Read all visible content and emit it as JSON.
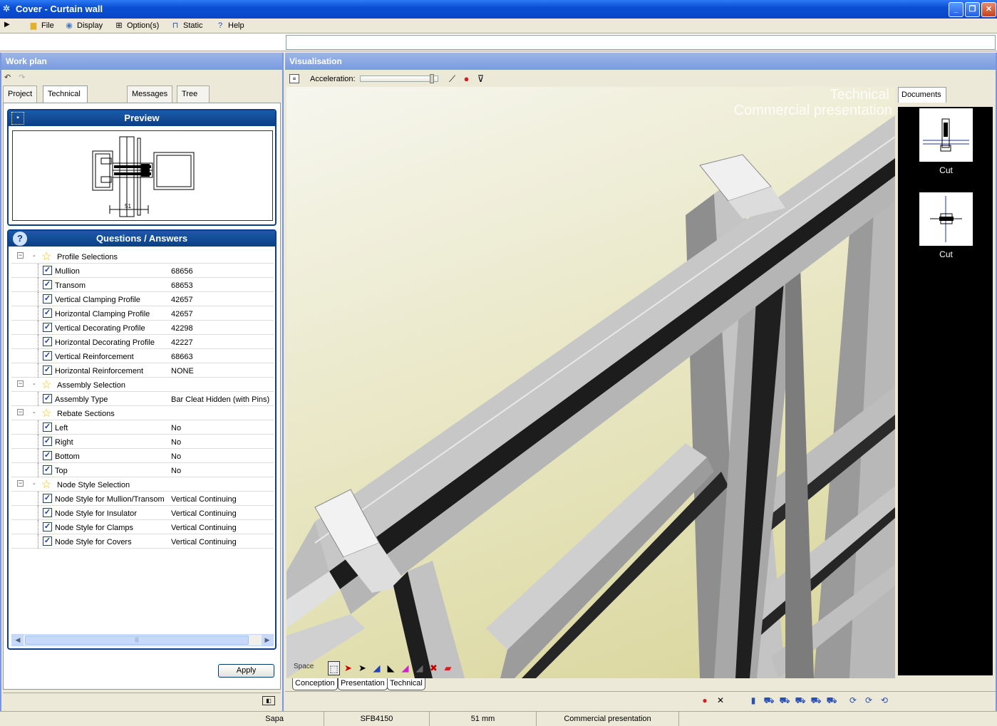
{
  "window": {
    "title": "Cover - Curtain wall",
    "minimize_glyph": "_",
    "maximize_glyph": "❐",
    "close_glyph": "✕"
  },
  "menu": {
    "items": [
      {
        "label": "File",
        "icon": "folder-icon"
      },
      {
        "label": "Display",
        "icon": "display-icon"
      },
      {
        "label": "Option(s)",
        "icon": "options-icon"
      },
      {
        "label": "Static",
        "icon": "static-icon"
      },
      {
        "label": "Help",
        "icon": "help-icon"
      }
    ]
  },
  "left_panel": {
    "header": "Work plan",
    "tabs": [
      {
        "label": "Project"
      },
      {
        "label": "Technical properties",
        "active": true
      },
      {
        "label": "Messages"
      },
      {
        "label": "Tree view cutting list"
      }
    ],
    "preview": {
      "title": "Preview",
      "dimension_label": "51"
    },
    "qa": {
      "title": "Questions / Answers",
      "groups": [
        {
          "label": "Profile Selections",
          "items": [
            {
              "q": "Mullion",
              "a": "68656"
            },
            {
              "q": "Transom",
              "a": "68653"
            },
            {
              "q": "Vertical Clamping Profile",
              "a": "42657"
            },
            {
              "q": "Horizontal Clamping Profile",
              "a": "42657"
            },
            {
              "q": "Vertical Decorating Profile",
              "a": "42298"
            },
            {
              "q": "Horizontal Decorating Profile",
              "a": "42227"
            },
            {
              "q": "Vertical Reinforcement",
              "a": "68663"
            },
            {
              "q": "Horizontal Reinforcement",
              "a": "NONE"
            }
          ]
        },
        {
          "label": "Assembly Selection",
          "items": [
            {
              "q": "Assembly Type",
              "a": "Bar Cleat Hidden (with Pins)"
            }
          ]
        },
        {
          "label": "Rebate Sections",
          "items": [
            {
              "q": "Left",
              "a": "No"
            },
            {
              "q": "Right",
              "a": "No"
            },
            {
              "q": "Bottom",
              "a": "No"
            },
            {
              "q": "Top",
              "a": "No"
            }
          ]
        },
        {
          "label": "Node Style Selection",
          "items": [
            {
              "q": "Node Style for Mullion/Transom",
              "a": "Vertical Continuing"
            },
            {
              "q": "Node Style for Insulator",
              "a": "Vertical Continuing"
            },
            {
              "q": "Node Style for Clamps",
              "a": "Vertical Continuing"
            },
            {
              "q": "Node Style for Covers",
              "a": "Vertical Continuing"
            }
          ]
        }
      ]
    },
    "apply_label": "Apply"
  },
  "right_panel": {
    "header": "Visualisation",
    "acceleration_label": "Acceleration:",
    "acceleration_level": 0.95,
    "overlay_lines": [
      "Technical",
      "Commercial presentation"
    ],
    "mode_label": "Space",
    "documents_tab": "Documents",
    "documents": [
      {
        "caption": "Cut"
      },
      {
        "caption": "Cut"
      }
    ],
    "view_tabs": [
      {
        "label": "Conception"
      },
      {
        "label": "Presentation"
      },
      {
        "label": "Technical"
      }
    ]
  },
  "status": {
    "cells": [
      "Sapa",
      "SFB4150",
      "51 mm",
      "Commercial presentation"
    ]
  },
  "colors": {
    "title_blue": "#0a4fd4",
    "box_blue": "#0b3f8a",
    "panel_header": "#7a9be0"
  }
}
